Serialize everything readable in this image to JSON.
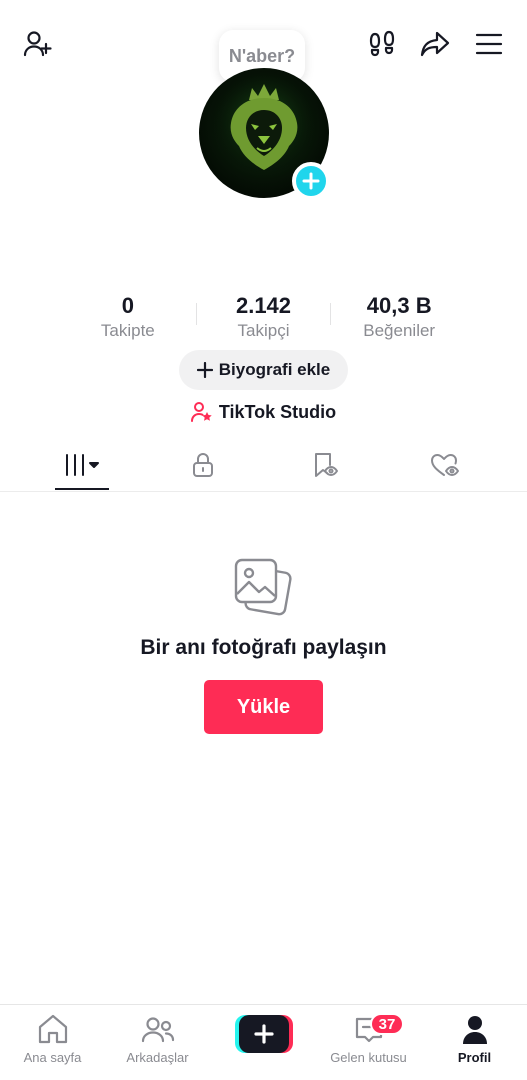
{
  "header": {
    "status_bubble": "N'aber?",
    "icons": [
      "add-friend-icon",
      "footprints-icon",
      "share-icon",
      "menu-icon"
    ]
  },
  "profile": {
    "stats": [
      {
        "value": "0",
        "label": "Takipte"
      },
      {
        "value": "2.142",
        "label": "Takipçi"
      },
      {
        "value": "40,3 B",
        "label": "Beğeniler"
      }
    ],
    "bio_button_label": "Biyografi ekle",
    "studio_label": "TikTok Studio"
  },
  "tabs": [
    {
      "icon": "grid-icon",
      "active": true
    },
    {
      "icon": "lock-icon",
      "active": false
    },
    {
      "icon": "bookmark-eye-icon",
      "active": false
    },
    {
      "icon": "heart-eye-icon",
      "active": false
    }
  ],
  "empty_state": {
    "icon": "photos-icon",
    "title": "Bir anı fotoğrafı paylaşın",
    "button_label": "Yükle"
  },
  "bottom_nav": {
    "items": [
      {
        "label": "Ana sayfa",
        "icon": "home-icon"
      },
      {
        "label": "Arkadaşlar",
        "icon": "friends-icon"
      },
      {
        "label": "",
        "icon": "create-icon"
      },
      {
        "label": "Gelen kutusu",
        "icon": "inbox-icon",
        "badge": "37"
      },
      {
        "label": "Profil",
        "icon": "profile-icon",
        "active": true
      }
    ]
  },
  "colors": {
    "accent_red": "#fe2c55",
    "accent_cyan": "#20d5ec",
    "text_primary": "#161823",
    "text_secondary": "#8a8b91"
  }
}
